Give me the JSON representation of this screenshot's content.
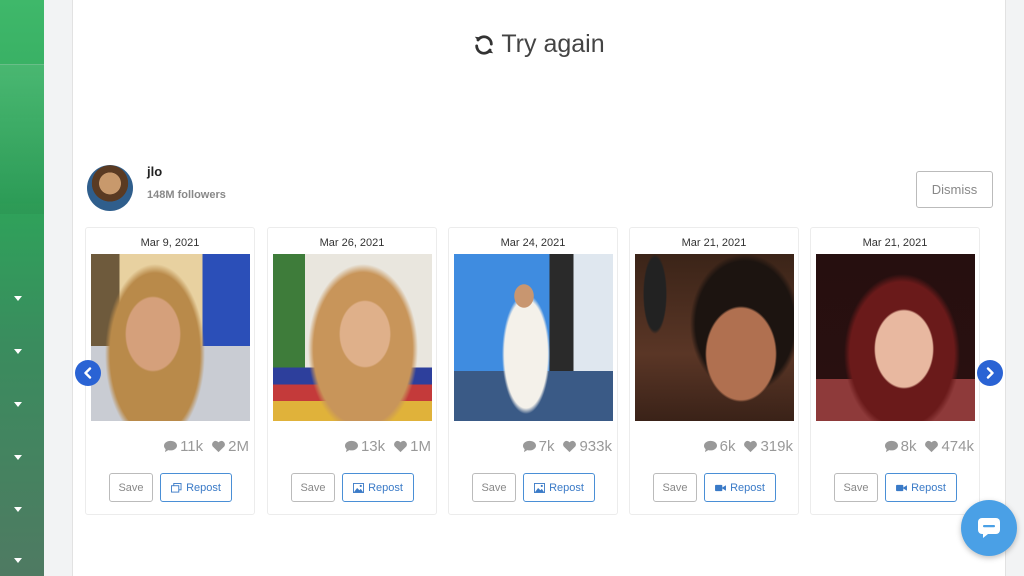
{
  "page": {
    "try_again_label": "Try again"
  },
  "profile": {
    "username": "jlo",
    "followers": "148M followers",
    "dismiss_label": "Dismiss"
  },
  "posts": [
    {
      "date": "Mar 9, 2021",
      "comments": "11k",
      "likes": "2M",
      "save_label": "Save",
      "repost_label": "Repost",
      "repost_icon": "copy-icon"
    },
    {
      "date": "Mar 26, 2021",
      "comments": "13k",
      "likes": "1M",
      "save_label": "Save",
      "repost_label": "Repost",
      "repost_icon": "image-icon"
    },
    {
      "date": "Mar 24, 2021",
      "comments": "7k",
      "likes": "933k",
      "save_label": "Save",
      "repost_label": "Repost",
      "repost_icon": "image-icon"
    },
    {
      "date": "Mar 21, 2021",
      "comments": "6k",
      "likes": "319k",
      "save_label": "Save",
      "repost_label": "Repost",
      "repost_icon": "video-icon"
    },
    {
      "date": "Mar 21, 2021",
      "comments": "8k",
      "likes": "474k",
      "save_label": "Save",
      "repost_label": "Repost",
      "repost_icon": "video-icon"
    }
  ],
  "colors": {
    "accent": "#2a63d4",
    "sidebar": "#3fb86a",
    "chat": "#4aa0e6"
  }
}
